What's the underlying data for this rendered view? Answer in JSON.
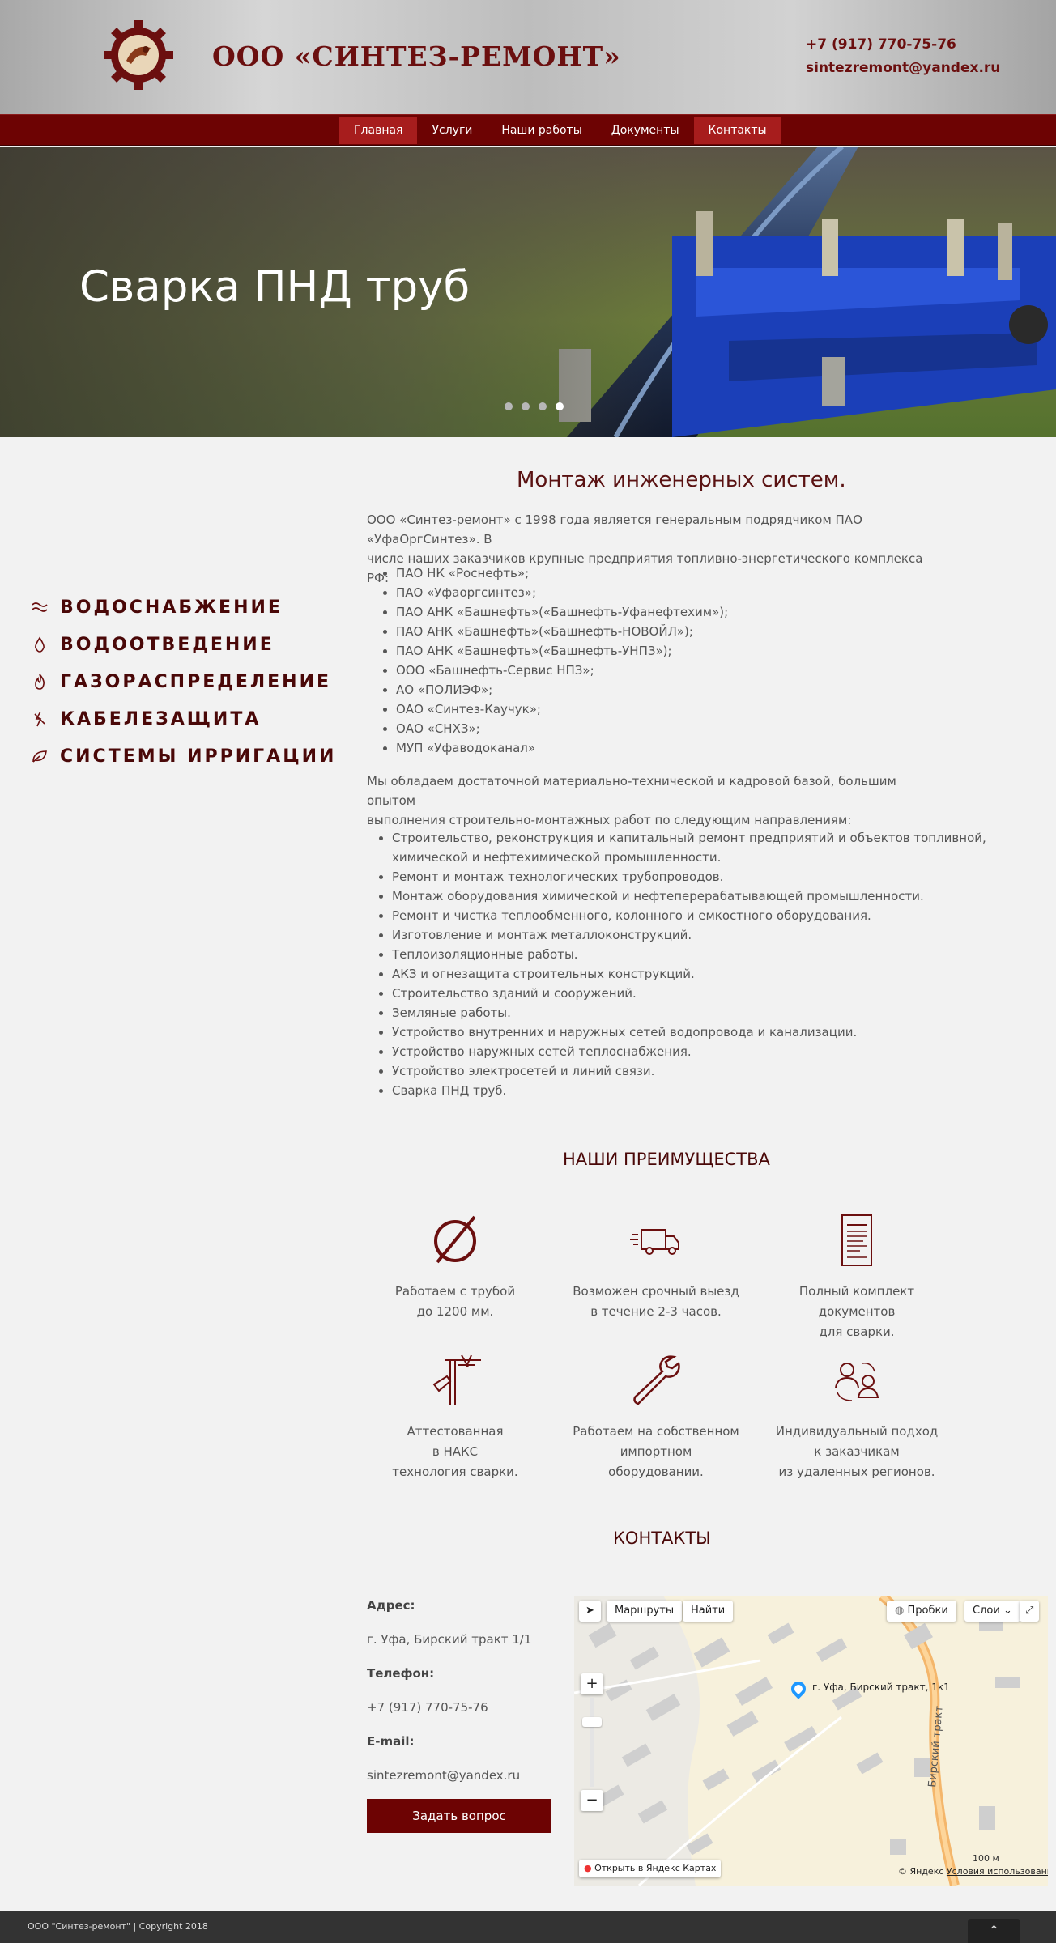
{
  "header": {
    "company": "ООО  «СИНТЕЗ-РЕМОНТ»",
    "phone": "+7 (917) 770-75-76",
    "email": "sintezremont@yandex.ru"
  },
  "nav": {
    "items": [
      {
        "label": "Главная",
        "active": true
      },
      {
        "label": "Услуги",
        "active": false
      },
      {
        "label": "Наши работы",
        "active": false
      },
      {
        "label": "Документы",
        "active": false
      },
      {
        "label": "Контакты",
        "active": true
      }
    ]
  },
  "hero": {
    "title": "Сварка ПНД труб",
    "slides_count": 4,
    "active_slide": 4
  },
  "side_menu": {
    "items": [
      {
        "label": "ВОДОСНАБЖЕНИЕ",
        "icon": "waves-icon"
      },
      {
        "label": "ВОДООТВЕДЕНИЕ",
        "icon": "drop-icon"
      },
      {
        "label": "ГАЗОРАСПРЕДЕЛЕНИЕ",
        "icon": "flame-icon"
      },
      {
        "label": "КАБЕЛЕЗАЩИТА",
        "icon": "lightning-icon"
      },
      {
        "label": "СИСТЕМЫ ИРРИГАЦИИ",
        "icon": "leaf-icon"
      }
    ]
  },
  "main": {
    "title": "Монтаж инженерных систем.",
    "intro_line1": "ООО «Синтез-ремонт» с 1998 года является генеральным подрядчиком ПАО «УфаОргСинтез». В",
    "intro_line2": "числе наших заказчиков крупные предприятия топливно-энергетического комплекса РФ:",
    "clients": [
      "ПАО НК «Роснефть»;",
      "ПАО «Уфаоргсинтез»;",
      "ПАО АНК «Башнефть»(«Башнефть-Уфанефтехим»);",
      "ПАО АНК «Башнефть»(«Башнефть-НОВОЙЛ»);",
      "ПАО АНК «Башнефть»(«Башнефть-УНПЗ»);",
      "ООО «Башнефть-Сервис НПЗ»;",
      "АО «ПОЛИЭФ»;",
      "ОАО «Синтез-Каучук»;",
      "ОАО «СНХЗ»;",
      "МУП «Уфаводоканал»"
    ],
    "para2_line1": "Мы обладаем достаточной материально-технической и кадровой базой, большим опытом",
    "para2_line2": "выполнения строительно-монтажных работ по следующим направлениям:",
    "services": [
      "Строительство, реконструкция и капитальный ремонт предприятий и объектов топливной,",
      "химической и нефтехимической промышленности.",
      "Ремонт и монтаж технологических трубопроводов.",
      "Монтаж оборудования химической и нефтеперерабатывающей промышленности.",
      "Ремонт и чистка теплообменного, колонного и емкостного оборудования.",
      "Изготовление и монтаж металлоконструкций.",
      "Теплоизоляционные работы.",
      "АКЗ и огнезащита строительных конструкций.",
      "Строительство зданий и сооружений.",
      "Земляные работы.",
      "Устройство внутренних и наружных сетей водопровода и канализации.",
      "Устройство наружных сетей теплоснабжения.",
      "Устройство электросетей и линий связи.",
      "Сварка ПНД труб."
    ]
  },
  "advantages": {
    "title": "НАШИ ПРЕИМУЩЕСТВА",
    "items": [
      {
        "icon": "pipe-diameter-icon",
        "lines": [
          "Работаем с трубой",
          "до 1200 мм."
        ]
      },
      {
        "icon": "delivery-truck-icon",
        "lines": [
          "Возможен срочный выезд",
          "в течение 2-3 часов."
        ]
      },
      {
        "icon": "document-icon",
        "lines": [
          "Полный комплект документов",
          "для сварки."
        ]
      },
      {
        "icon": "welding-icon",
        "lines": [
          "Аттестованная",
          "в НАКС",
          "технология сварки."
        ]
      },
      {
        "icon": "wrench-icon",
        "lines": [
          "Работаем на собственном",
          "импортном",
          "оборудовании."
        ]
      },
      {
        "icon": "people-icon",
        "lines": [
          "Индивидуальный подход",
          "к заказчикам",
          "из удаленных регионов."
        ]
      }
    ]
  },
  "contacts": {
    "title": "КОНТАКТЫ",
    "address_label": "Адрес:",
    "address": "г. Уфа, Бирский тракт 1/1",
    "phone_label": "Телефон:",
    "phone": "+7 (917) 770-75-76",
    "email_label": "E-mail:",
    "email": "sintezremont@yandex.ru",
    "ask_button": "Задать вопрос"
  },
  "map": {
    "routes": "Маршруты",
    "find": "Найти",
    "traffic": "Пробки",
    "layers": "Слои",
    "marker": "г. Уфа, Бирский тракт, 1к1",
    "road": "Бирский тракт",
    "open_in": "Открыть в Яндекс Картах",
    "copyright": "© Яндекс",
    "terms": "Условия использования",
    "scale": "100 м",
    "zoom_in": "+",
    "zoom_out": "−"
  },
  "footer": {
    "text": "ООО \"Синтез-ремонт\" | Copyright 2018",
    "to_top": "⌃"
  },
  "colors": {
    "brand": "#6b0f0f",
    "nav_bg": "#6d0303",
    "nav_active": "#a71d1d",
    "footer_bg": "#333333"
  }
}
